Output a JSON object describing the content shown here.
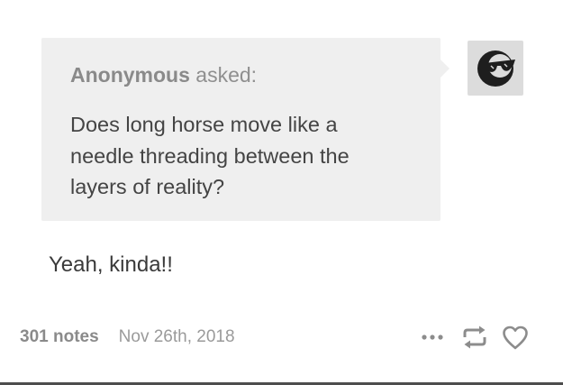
{
  "ask": {
    "asker_name": "Anonymous",
    "asker_suffix": " asked:",
    "question": "Does long horse move like a needle threading between the layers of reality?"
  },
  "avatar": {
    "icon": "sunglasses-face-icon"
  },
  "answer": {
    "text": "Yeah, kinda!!"
  },
  "footer": {
    "notes": "301 notes",
    "date": "Nov 26th, 2018"
  },
  "controls": {
    "more_icon": "more-dots-icon",
    "reblog_icon": "reblog-icon",
    "like_icon": "heart-icon"
  },
  "colors": {
    "bubble_background": "#efefef",
    "avatar_background": "#dcdcdc",
    "text": "#444444",
    "muted_text": "#8f8f8f",
    "icon": "#8c8c8c"
  }
}
